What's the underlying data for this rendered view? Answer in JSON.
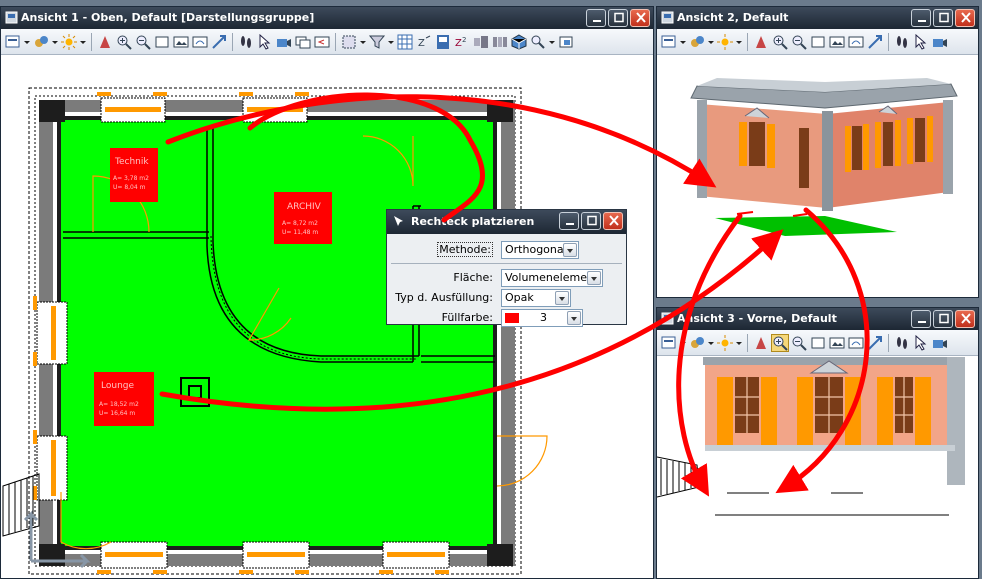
{
  "windows": {
    "view1": {
      "title": "Ansicht 1 - Oben, Default [Darstellungsgruppe]"
    },
    "view2": {
      "title": "Ansicht 2, Default"
    },
    "view3": {
      "title": "Ansicht 3 - Vorne, Default"
    }
  },
  "rooms": [
    {
      "name": "Technik",
      "area": "A= 3,78 m2",
      "perimeter": "U= 8,04 m"
    },
    {
      "name": "ARCHIV",
      "area": "A= 8,72 m2",
      "perimeter": "U= 11,48 m"
    },
    {
      "name": "Lounge",
      "area": "A= 18,52 m2",
      "perimeter": "U= 16,64 m"
    }
  ],
  "dialog": {
    "title": "Rechteck platzieren",
    "fields": [
      {
        "label": "Methode:",
        "value": "Orthogonal"
      },
      {
        "label": "Fläche:",
        "value": "Volumenelement"
      },
      {
        "label": "Typ d. Ausfüllung:",
        "value": "Opak"
      },
      {
        "label": "Füllfarbe:",
        "value": "3"
      }
    ]
  },
  "colors": {
    "floor": "#00ff00",
    "room_label": "#ff0000",
    "arrow": "#ff0000",
    "window_frame": "#ff9900",
    "titlebar": "#1d2733"
  },
  "icons": [
    "view-attributes-icon",
    "display-style-icon",
    "lighting-icon",
    "fit-view-icon",
    "zoom-in-icon",
    "zoom-out-icon",
    "window-area-icon",
    "view-previous-icon",
    "rotate-view-icon",
    "walk-icon",
    "select-icon",
    "camera-icon"
  ]
}
